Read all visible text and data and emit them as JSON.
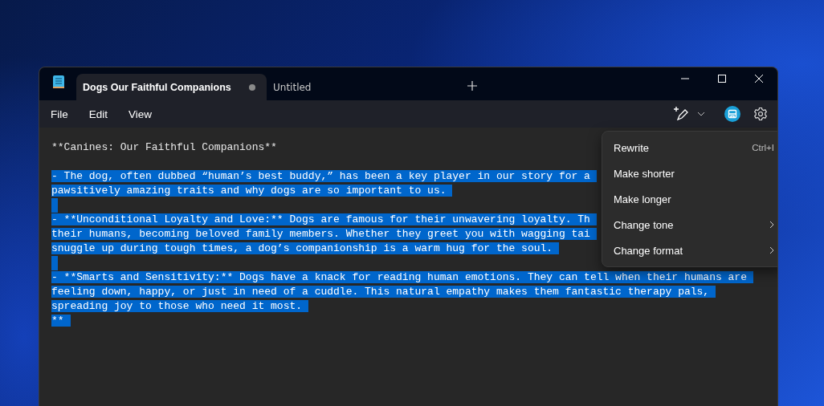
{
  "tabs": [
    {
      "label": "Dogs Our Faithful Companions",
      "selected": true,
      "modified": true
    },
    {
      "label": "Untitled",
      "selected": false,
      "modified": false
    }
  ],
  "menu_bar": [
    "File",
    "Edit",
    "View"
  ],
  "editor": {
    "lines": [
      {
        "text": "**Canines: Our Faithful Companions**",
        "selected": false
      },
      {
        "selected": false
      },
      {
        "text": "- The dog, often dubbed “human’s best buddy,” has been a key player in our story for a",
        "selected": true
      },
      {
        "text": "pawsitively amazing traits and why dogs are so important to us.",
        "selected": true
      },
      {
        "selected": true
      },
      {
        "text": "- **Unconditional Loyalty and Love:** Dogs are famous for their unwavering loyalty. Th",
        "selected": true
      },
      {
        "text": "their humans, becoming beloved family members. Whether they greet you with wagging tai",
        "selected": true
      },
      {
        "text": "snuggle up during tough times, a dog’s companionship is a warm hug for the soul.",
        "selected": true
      },
      {
        "selected": true
      },
      {
        "text": "- **Smarts and Sensitivity:** Dogs have a knack for reading human emotions. They can tell when their humans are",
        "selected": true
      },
      {
        "text": "feeling down, happy, or just in need of a cuddle. This natural empathy makes them fantastic therapy pals,",
        "selected": true
      },
      {
        "text": "spreading joy to those who need it most.",
        "selected": true
      },
      {
        "text": "**",
        "selected": true
      }
    ]
  },
  "context_menu": [
    {
      "label": "Rewrite",
      "shortcut": "Ctrl+I",
      "submenu": false
    },
    {
      "label": "Make shorter",
      "submenu": false
    },
    {
      "label": "Make longer",
      "submenu": false
    },
    {
      "label": "Change tone",
      "submenu": true
    },
    {
      "label": "Change format",
      "submenu": true
    }
  ]
}
